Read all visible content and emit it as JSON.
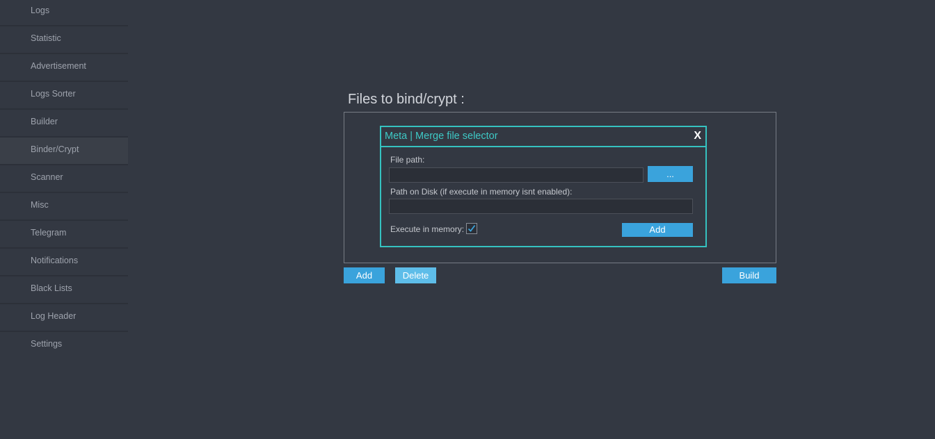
{
  "sidebar": {
    "items": [
      {
        "label": "Logs"
      },
      {
        "label": "Statistic"
      },
      {
        "label": "Advertisement"
      },
      {
        "label": "Logs Sorter"
      },
      {
        "label": "Builder"
      },
      {
        "label": "Binder/Crypt",
        "active": true
      },
      {
        "label": "Scanner"
      },
      {
        "label": "Misc"
      },
      {
        "label": "Telegram"
      },
      {
        "label": "Notifications"
      },
      {
        "label": "Black Lists"
      },
      {
        "label": "Log Header"
      },
      {
        "label": "Settings"
      }
    ]
  },
  "main": {
    "title": "Files to bind/crypt :",
    "add_label": "Add",
    "delete_label": "Delete",
    "build_label": "Build"
  },
  "dialog": {
    "title": "Meta | Merge file selector",
    "close_label": "X",
    "file_path_label": "File path:",
    "file_path_value": "",
    "browse_label": "...",
    "disk_path_label": "Path on Disk (if execute in memory isnt enabled):",
    "disk_path_value": "",
    "execute_label": "Execute in memory:",
    "execute_checked": true,
    "add_label": "Add"
  },
  "colors": {
    "background": "#333842",
    "accent": "#3aa3dc",
    "dialog_border": "#35c2c0"
  }
}
